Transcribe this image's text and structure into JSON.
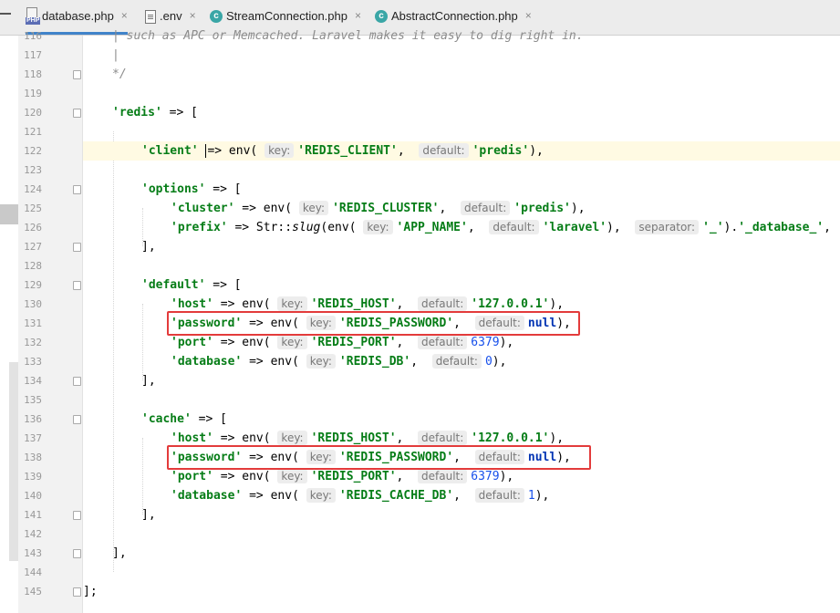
{
  "tabs": [
    {
      "label": "database.php",
      "icon": "php-file-icon",
      "active": true
    },
    {
      "label": ".env",
      "icon": "text-file-icon",
      "active": false
    },
    {
      "label": "StreamConnection.php",
      "icon": "class-icon",
      "active": false
    },
    {
      "label": "AbstractConnection.php",
      "icon": "class-icon",
      "active": false
    }
  ],
  "tab_close_glyph": "×",
  "php_icon_label": "PHP",
  "class_icon_glyph": "c",
  "lines": [
    {
      "n": "116",
      "code": "| such as APC or Memcached. Laravel makes it easy to dig right in."
    },
    {
      "n": "117",
      "code": "|"
    },
    {
      "n": "118",
      "code": "*/"
    },
    {
      "n": "119",
      "code": ""
    },
    {
      "n": "120",
      "code": "'redis' => ["
    },
    {
      "n": "121",
      "code": ""
    },
    {
      "n": "122",
      "code": "'client' => env( key: 'REDIS_CLIENT', default: 'predis'),"
    },
    {
      "n": "123",
      "code": ""
    },
    {
      "n": "124",
      "code": "'options' => ["
    },
    {
      "n": "125",
      "code": "'cluster' => env( key: 'REDIS_CLUSTER', default: 'predis'),"
    },
    {
      "n": "126",
      "code": "'prefix' => Str::slug(env( key: 'APP_NAME', default: 'laravel'), separator: '_').'_database_',"
    },
    {
      "n": "127",
      "code": "],"
    },
    {
      "n": "128",
      "code": ""
    },
    {
      "n": "129",
      "code": "'default' => ["
    },
    {
      "n": "130",
      "code": "'host' => env( key: 'REDIS_HOST', default: '127.0.0.1'),"
    },
    {
      "n": "131",
      "code": "'password' => env( key: 'REDIS_PASSWORD', default: null),"
    },
    {
      "n": "132",
      "code": "'port' => env( key: 'REDIS_PORT', default: 6379),"
    },
    {
      "n": "133",
      "code": "'database' => env( key: 'REDIS_DB', default: 0),"
    },
    {
      "n": "134",
      "code": "],"
    },
    {
      "n": "135",
      "code": ""
    },
    {
      "n": "136",
      "code": "'cache' => ["
    },
    {
      "n": "137",
      "code": "'host' => env( key: 'REDIS_HOST', default: '127.0.0.1'),"
    },
    {
      "n": "138",
      "code": "'password' => env( key: 'REDIS_PASSWORD', default: null),"
    },
    {
      "n": "139",
      "code": "'port' => env( key: 'REDIS_PORT', default: 6379),"
    },
    {
      "n": "140",
      "code": "'database' => env( key: 'REDIS_CACHE_DB', default: 1),"
    },
    {
      "n": "141",
      "code": "],"
    },
    {
      "n": "142",
      "code": ""
    },
    {
      "n": "143",
      "code": "],"
    },
    {
      "n": "144",
      "code": ""
    },
    {
      "n": "145",
      "code": "];"
    }
  ],
  "current_line": "122",
  "highlighted_lines": [
    "131",
    "138"
  ],
  "colors": {
    "string": "#067d17",
    "number": "#1750eb",
    "keyword": "#0033b3",
    "comment": "#8c8c8c",
    "highlight_box": "#e33b3b",
    "active_tab_underline": "#4083c9",
    "current_line_bg": "#fffae3"
  }
}
